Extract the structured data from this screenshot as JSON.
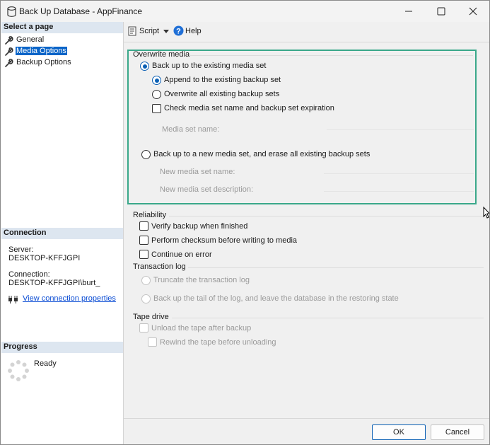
{
  "window": {
    "title": "Back Up Database - AppFinance",
    "icon": "database-icon",
    "controls": [
      "minimize",
      "maximize",
      "close"
    ]
  },
  "left_panel": {
    "select_page_heading": "Select a page",
    "pages": [
      {
        "label": "General",
        "icon": "wrench-icon",
        "selected": false
      },
      {
        "label": "Media Options",
        "icon": "wrench-icon",
        "selected": true
      },
      {
        "label": "Backup Options",
        "icon": "wrench-icon",
        "selected": false
      }
    ],
    "connection_heading": "Connection",
    "server_label": "Server:",
    "server_value": "DESKTOP-KFFJGPI",
    "connection_label": "Connection:",
    "connection_value": "DESKTOP-KFFJGPI\\burt_",
    "view_connection_link": "View connection properties",
    "progress_heading": "Progress",
    "progress_status": "Ready"
  },
  "toolbar": {
    "script_label": "Script",
    "help_label": "Help"
  },
  "overwrite_media": {
    "heading": "Overwrite media",
    "existing_set_label": "Back up to the existing media set",
    "append_label": "Append to the existing backup set",
    "overwrite_label": "Overwrite all existing backup sets",
    "check_name_label": "Check media set name and backup set expiration",
    "media_set_name_label": "Media set name:",
    "media_set_name_value": "",
    "new_set_label": "Back up to a new media set, and erase all existing backup sets",
    "new_media_name_label": "New media set name:",
    "new_media_name_value": "",
    "new_media_desc_label": "New media set description:",
    "new_media_desc_value": ""
  },
  "reliability": {
    "heading": "Reliability",
    "verify_label": "Verify backup when finished",
    "checksum_label": "Perform checksum before writing to media",
    "continue_label": "Continue on error"
  },
  "transaction_log": {
    "heading": "Transaction log",
    "truncate_label": "Truncate the transaction log",
    "tail_label": "Back up the tail of the log, and leave the database in the restoring state"
  },
  "tape_drive": {
    "heading": "Tape drive",
    "unload_label": "Unload the tape after backup",
    "rewind_label": "Rewind the tape before unloading"
  },
  "buttons": {
    "ok": "OK",
    "cancel": "Cancel"
  },
  "colors": {
    "accent": "#0a5fb4",
    "highlight_border": "#3aa88a",
    "selected_bg": "#0a64c8",
    "section_header_bg": "#dde6f0",
    "link": "#0a4cd4"
  }
}
